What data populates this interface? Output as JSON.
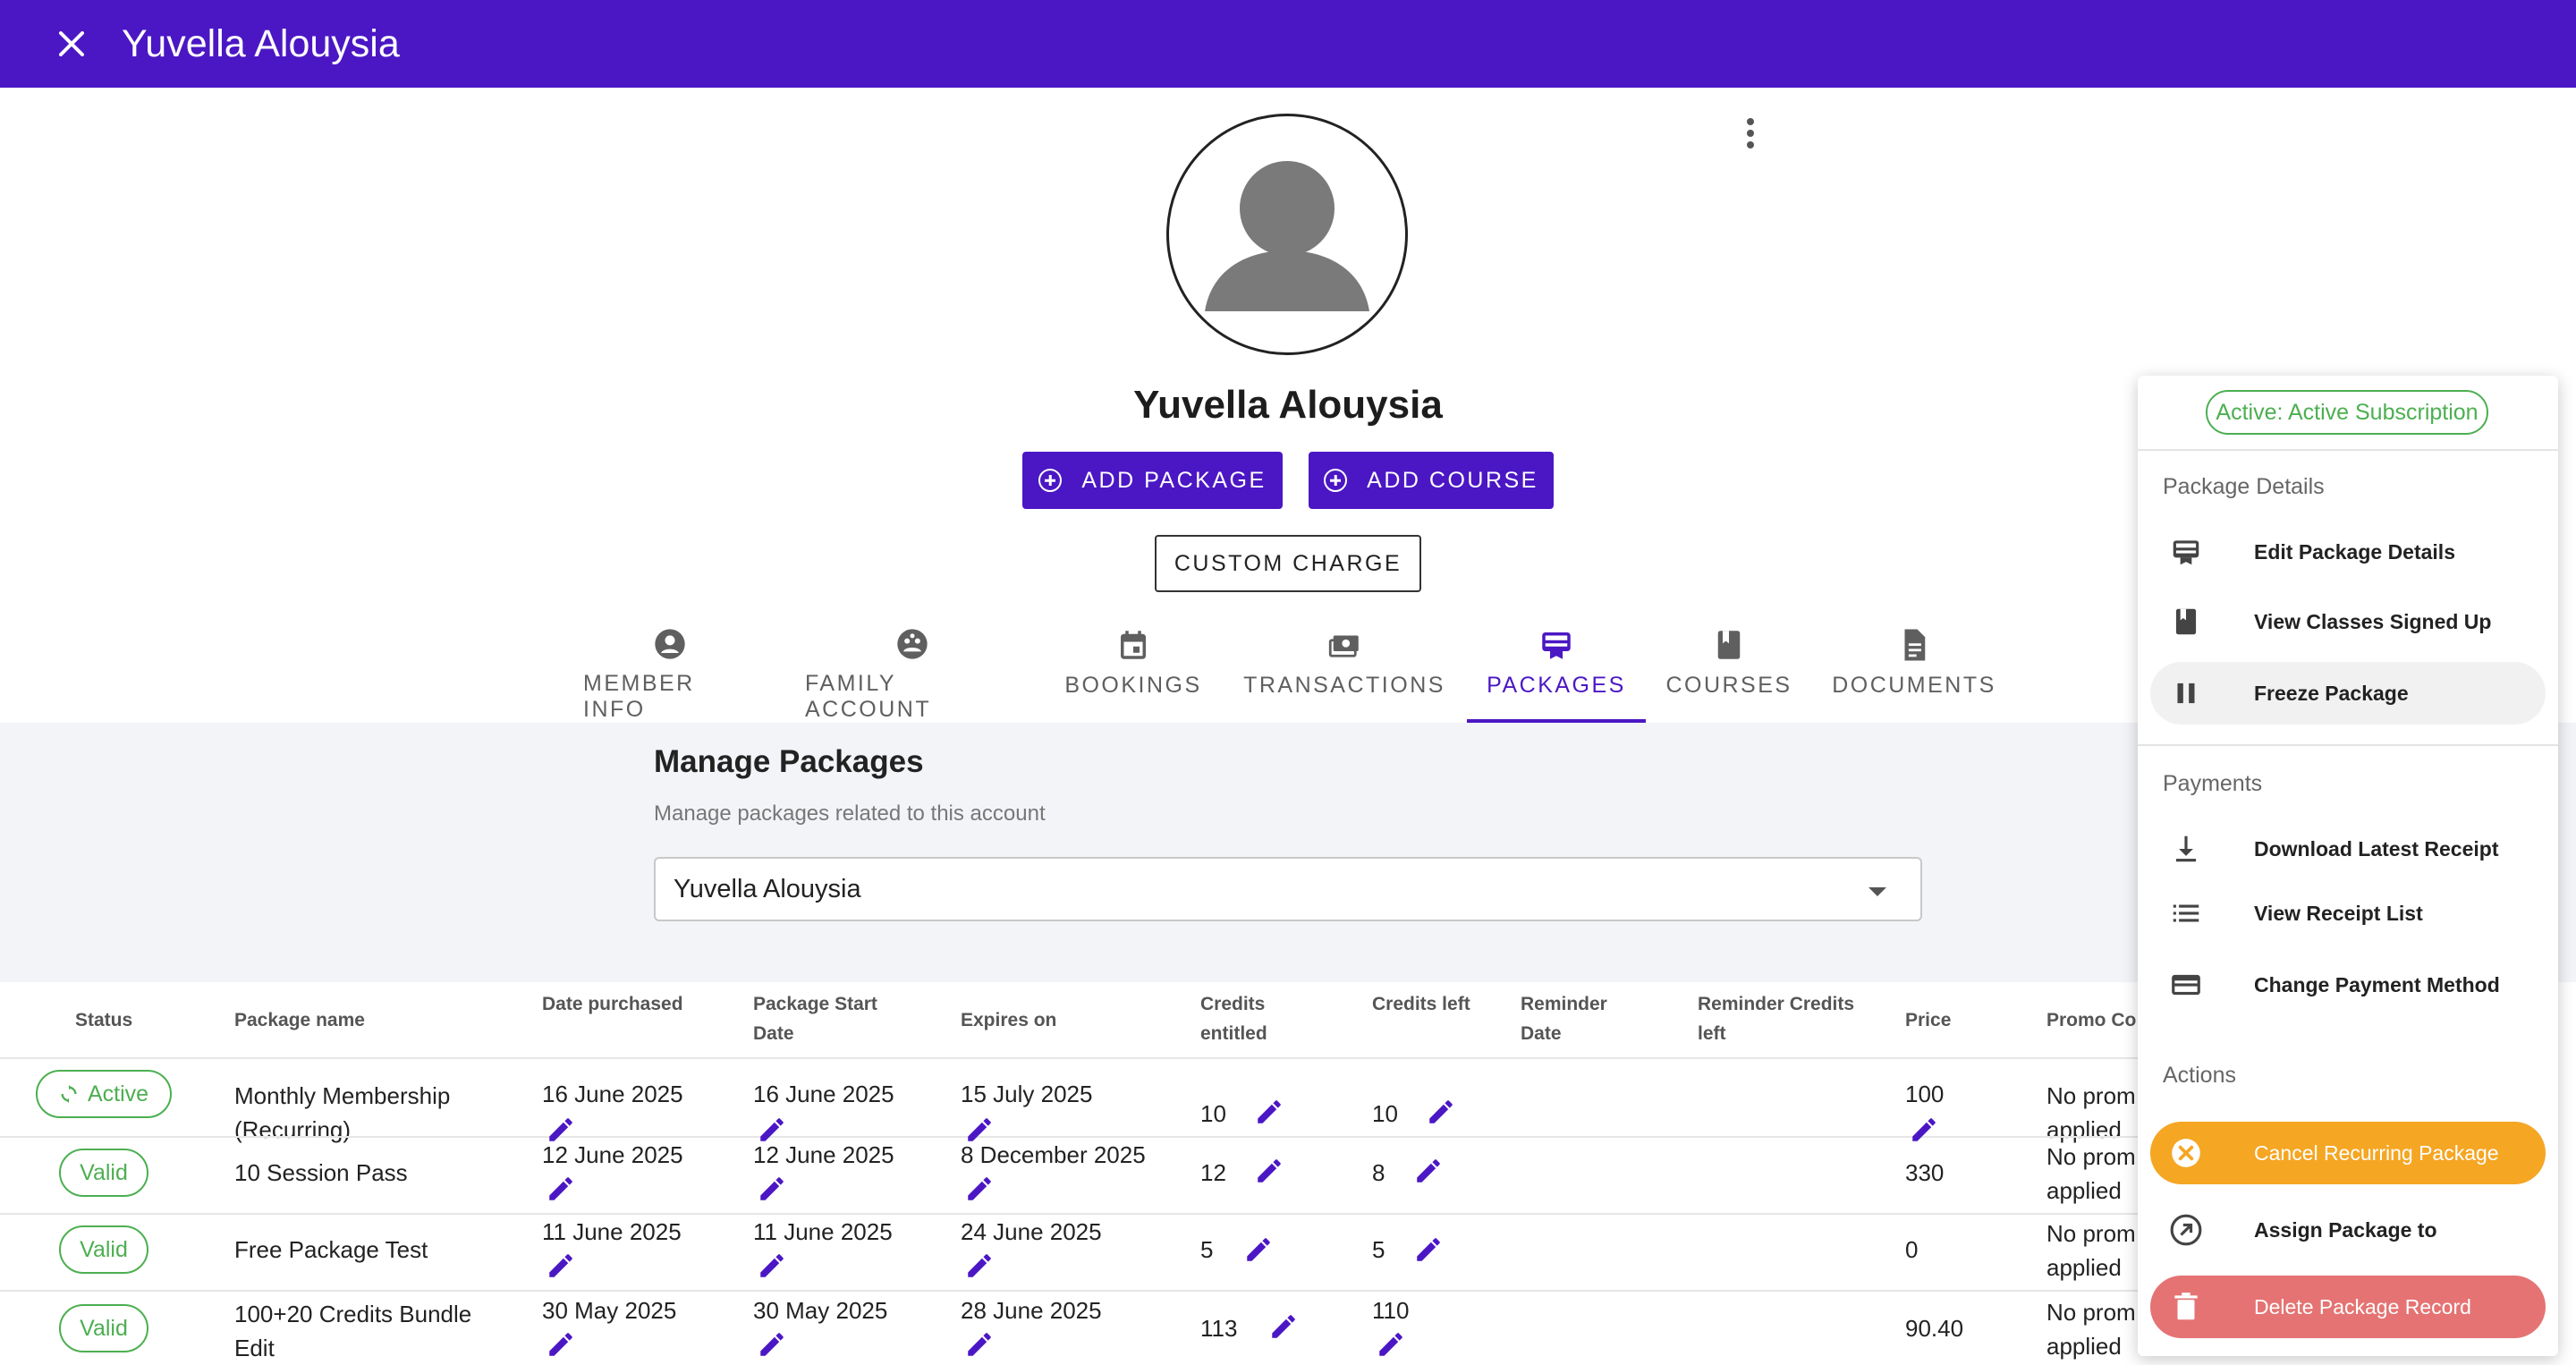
{
  "window": {
    "title": "Yuvella Alouysia"
  },
  "profile": {
    "name": "Yuvella Alouysia",
    "add_package_label": "ADD PACKAGE",
    "add_course_label": "ADD COURSE",
    "custom_charge_label": "CUSTOM CHARGE"
  },
  "tabs": [
    {
      "label": "MEMBER INFO",
      "icon": "account-circle-icon"
    },
    {
      "label": "FAMILY ACCOUNT",
      "icon": "family-icon"
    },
    {
      "label": "BOOKINGS",
      "icon": "calendar-icon"
    },
    {
      "label": "TRANSACTIONS",
      "icon": "payments-icon"
    },
    {
      "label": "PACKAGES",
      "icon": "card-icon",
      "active": true
    },
    {
      "label": "COURSES",
      "icon": "book-icon"
    },
    {
      "label": "DOCUMENTS",
      "icon": "document-icon"
    }
  ],
  "manage": {
    "title": "Manage Packages",
    "subtitle": "Manage packages related to this account",
    "selected_member": "Yuvella Alouysia"
  },
  "table": {
    "headers": [
      "Status",
      "Package name",
      "Date purchased",
      "Package Start Date",
      "Expires on",
      "Credits entitled",
      "Credits left",
      "Reminder Date",
      "Reminder Credits left",
      "Price",
      "Promo Co"
    ],
    "rows": [
      {
        "status": "Active",
        "name_l1": "Monthly Membership",
        "name_l2": "(Recurring)",
        "purchased": "16 June 2025",
        "start": "16 June 2025",
        "expires": "15 July 2025",
        "entitled": "10",
        "left": "10",
        "price": "100",
        "promo_l1": "No prom",
        "promo_l2": "applied"
      },
      {
        "status": "Valid",
        "name_l1": "10 Session Pass",
        "name_l2": "",
        "purchased": "12 June 2025",
        "start": "12 June 2025",
        "expires": "8 December 2025",
        "entitled": "12",
        "left": "8",
        "price": "330",
        "promo_l1": "No prom",
        "promo_l2": "applied"
      },
      {
        "status": "Valid",
        "name_l1": "Free Package Test",
        "name_l2": "",
        "purchased": "11 June 2025",
        "start": "11 June 2025",
        "expires": "24 June 2025",
        "entitled": "5",
        "left": "5",
        "price": "0",
        "promo_l1": "No prom",
        "promo_l2": "applied"
      },
      {
        "status": "Valid",
        "name_l1": "100+20 Credits Bundle",
        "name_l2": "Edit",
        "purchased": "30 May 2025",
        "start": "30 May 2025",
        "expires": "28 June 2025",
        "entitled": "113",
        "left": "110",
        "price": "90.40",
        "promo_l1": "No prom",
        "promo_l2": "applied"
      }
    ]
  },
  "menu": {
    "status": "Active: Active Subscription",
    "package_section": "Package Details",
    "edit_details": "Edit Package Details",
    "view_classes": "View Classes Signed Up",
    "freeze": "Freeze Package",
    "payments_section": "Payments",
    "download_receipt": "Download Latest Receipt",
    "receipt_list": "View Receipt List",
    "change_payment": "Change Payment Method",
    "actions_section": "Actions",
    "cancel_recurring": "Cancel Recurring Package",
    "assign_package": "Assign Package to",
    "delete_record": "Delete Package Record"
  },
  "colors": {
    "brand": "#4b17c4",
    "status_green": "#4caf50",
    "cancel_orange": "#f5a623",
    "delete_red": "#e57373",
    "highlight_red": "#e53935"
  }
}
